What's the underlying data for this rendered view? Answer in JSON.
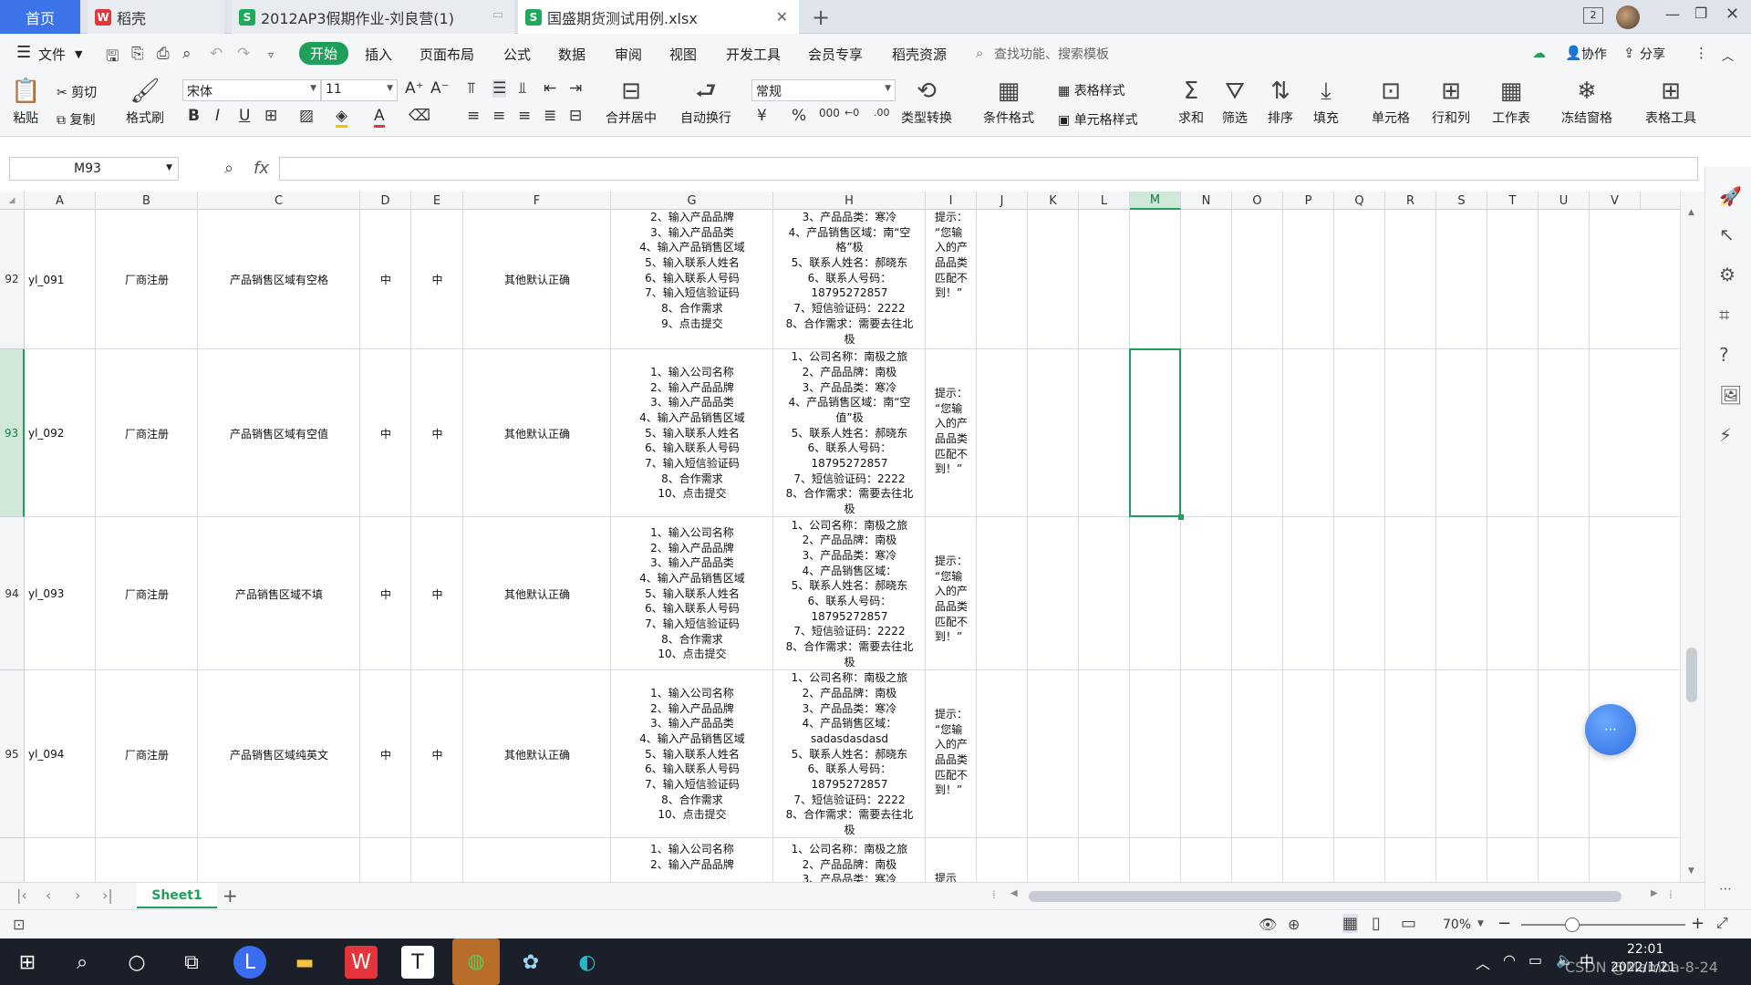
{
  "tabs": {
    "home": "首页",
    "wps": "稻壳",
    "doc1": "2012AP3假期作业-刘良营(1)",
    "doc2": "国盛期货测试用例.xlsx",
    "new": "+",
    "badge": "2"
  },
  "menu": [
    "文件",
    "开始",
    "插入",
    "页面布局",
    "公式",
    "数据",
    "审阅",
    "视图",
    "开发工具",
    "会员专享",
    "稻壳资源"
  ],
  "menu_search": "查找功能、搜索模板",
  "menu_right": {
    "collab": "协作",
    "share": "分享"
  },
  "ribbon": {
    "paste": "粘贴",
    "cut": "剪切",
    "copy": "复制",
    "format_painter": "格式刷",
    "font_name": "宋体",
    "font_size": "11",
    "merge": "合并居中",
    "wrap": "自动换行",
    "number_format": "常规",
    "type_convert": "类型转换",
    "cond_format": "条件格式",
    "table_style": "表格样式",
    "cell_style": "单元格样式",
    "sum": "求和",
    "filter": "筛选",
    "sort": "排序",
    "fill": "填充",
    "cell": "单元格",
    "rowcol": "行和列",
    "sheet": "工作表",
    "freeze": "冻结窗格",
    "tools": "表格工具"
  },
  "formula": {
    "namebox": "M93",
    "fx": "fx",
    "content": ""
  },
  "columns": [
    "A",
    "B",
    "C",
    "D",
    "E",
    "F",
    "G",
    "H",
    "I",
    "J",
    "K",
    "L",
    "M",
    "N",
    "O",
    "P",
    "Q",
    "R",
    "S",
    "T",
    "U",
    "V"
  ],
  "rows": [
    {
      "num": "92",
      "a": "yl_091",
      "b": "厂商注册",
      "c": "产品销售区域有空格",
      "d": "中",
      "e": "中",
      "f": "其他默认正确",
      "g": [
        "2、输入产品品牌",
        "3、输入产品品类",
        "4、输入产品销售区域",
        "5、输入联系人姓名",
        "6、输入联系人号码",
        "7、输入短信验证码",
        "8、合作需求",
        "9、点击提交"
      ],
      "h": [
        "3、产品品类：寒冷",
        "4、产品销售区域：南“空",
        "格”极",
        "5、联系人姓名：郝晓东",
        "6、联系人号码：",
        "18795272857",
        "7、短信验证码：2222",
        "8、合作需求：需要去往北",
        "极"
      ],
      "i": [
        "提示：",
        "“您输",
        "入的产",
        "品品类",
        "匹配不",
        "到！”"
      ]
    },
    {
      "num": "93",
      "a": "yl_092",
      "b": "厂商注册",
      "c": "产品销售区域有空值",
      "d": "中",
      "e": "中",
      "f": "其他默认正确",
      "g": [
        "1、输入公司名称",
        "2、输入产品品牌",
        "3、输入产品品类",
        "4、输入产品销售区域",
        "5、输入联系人姓名",
        "6、输入联系人号码",
        "7、输入短信验证码",
        "8、合作需求",
        "10、点击提交"
      ],
      "h": [
        "1、公司名称：南极之旅",
        "2、产品品牌：南极",
        "3、产品品类：寒冷",
        "4、产品销售区域：南“空",
        "值”极",
        "5、联系人姓名：郝晓东",
        "6、联系人号码：",
        "18795272857",
        "7、短信验证码：2222",
        "8、合作需求：需要去往北",
        "极"
      ],
      "i": [
        "提示：",
        "“您输",
        "入的产",
        "品品类",
        "匹配不",
        "到！”"
      ]
    },
    {
      "num": "94",
      "a": "yl_093",
      "b": "厂商注册",
      "c": "产品销售区域不填",
      "d": "中",
      "e": "中",
      "f": "其他默认正确",
      "g": [
        "1、输入公司名称",
        "2、输入产品品牌",
        "3、输入产品品类",
        "4、输入产品销售区域",
        "5、输入联系人姓名",
        "6、输入联系人号码",
        "7、输入短信验证码",
        "8、合作需求",
        "10、点击提交"
      ],
      "h": [
        "1、公司名称：南极之旅",
        "2、产品品牌：南极",
        "3、产品品类：寒冷",
        "4、产品销售区域：",
        "5、联系人姓名：郝晓东",
        "6、联系人号码：",
        "18795272857",
        "7、短信验证码：2222",
        "8、合作需求：需要去往北",
        "极"
      ],
      "i": [
        "提示：",
        "“您输",
        "入的产",
        "品品类",
        "匹配不",
        "到！”"
      ]
    },
    {
      "num": "95",
      "a": "yl_094",
      "b": "厂商注册",
      "c": "产品销售区域纯英文",
      "d": "中",
      "e": "中",
      "f": "其他默认正确",
      "g": [
        "1、输入公司名称",
        "2、输入产品品牌",
        "3、输入产品品类",
        "4、输入产品销售区域",
        "5、输入联系人姓名",
        "6、输入联系人号码",
        "7、输入短信验证码",
        "8、合作需求",
        "10、点击提交"
      ],
      "h": [
        "1、公司名称：南极之旅",
        "2、产品品牌：南极",
        "3、产品品类：寒冷",
        "4、产品销售区域：",
        "sadasdasdasd",
        "5、联系人姓名：郝晓东",
        "6、联系人号码：",
        "18795272857",
        "7、短信验证码：2222",
        "8、合作需求：需要去往北",
        "极"
      ],
      "i": [
        "提示：",
        "“您输",
        "入的产",
        "品品类",
        "匹配不",
        "到！”"
      ]
    },
    {
      "num": "",
      "a": "",
      "b": "",
      "c": "",
      "d": "",
      "e": "",
      "f": "",
      "g": [
        "1、输入公司名称",
        "2、输入产品品牌"
      ],
      "h": [
        "1、公司名称：南极之旅",
        "2、产品品牌：南极",
        "3、产品品类：寒冷"
      ],
      "i": [
        "提示"
      ]
    }
  ],
  "sheet_tab": "Sheet1",
  "status": {
    "zoom": "70%"
  },
  "taskbar": {
    "time": "22:01",
    "date": "2022/1/21",
    "watermark": "CSDN @Mamba-8-24"
  }
}
